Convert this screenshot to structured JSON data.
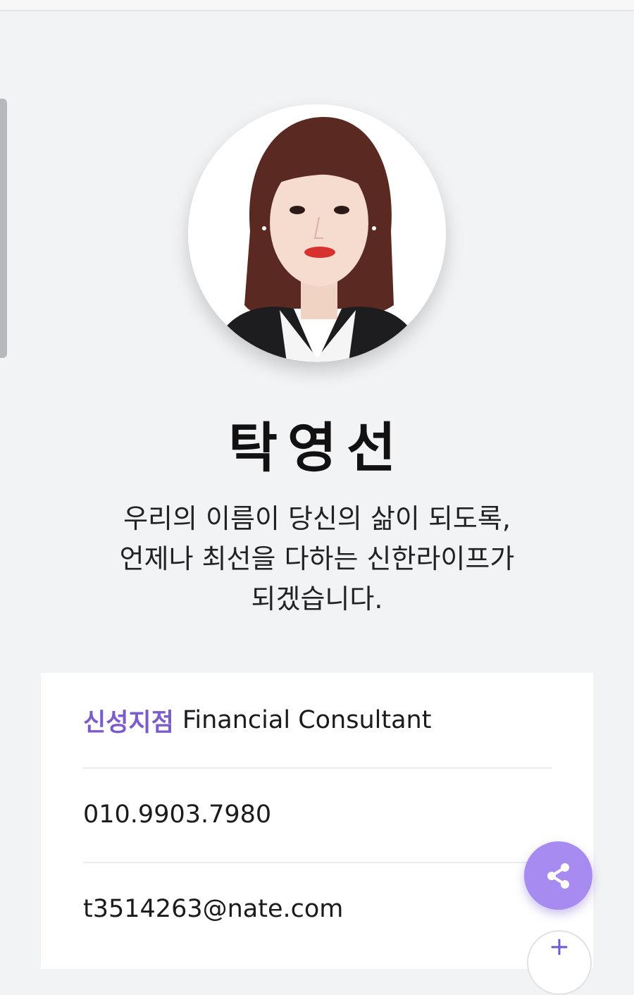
{
  "profile": {
    "name": "탁영선",
    "tagline_lines": [
      "우리의 이름이 당신의 삶이 되도록,",
      "언제나 최선을 다하는 신한라이프가",
      "되겠습니다."
    ]
  },
  "card": {
    "branch": "신성지점",
    "title": "Financial Consultant",
    "phone": "010.9903.7980",
    "email": "t3514263@nate.com"
  },
  "buttons": {
    "share_icon": "share-icon",
    "plus_icon": "plus-icon",
    "plus_glyph": "+"
  },
  "colors": {
    "accent": "#7b5ccd",
    "share_button": "#a78bf0",
    "background": "#f2f3f5"
  }
}
